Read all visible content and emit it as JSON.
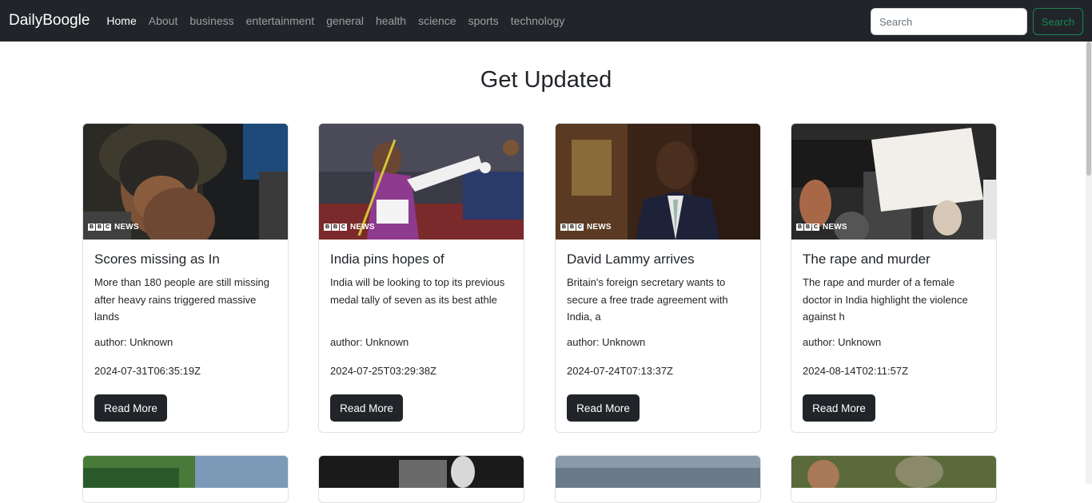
{
  "navbar": {
    "brand": "DailyBoogle",
    "links": [
      "Home",
      "About",
      "business",
      "entertainment",
      "general",
      "health",
      "science",
      "sports",
      "technology"
    ],
    "search_placeholder": "Search",
    "search_button": "Search"
  },
  "page": {
    "heading": "Get Updated"
  },
  "logo_text": {
    "bbc": [
      "B",
      "B",
      "C"
    ],
    "news": "NEWS"
  },
  "cards": [
    {
      "title": "Scores missing as In",
      "description": "More than 180 people are still missing after heavy rains triggered massive lands",
      "author": "author: Unknown",
      "date": "2024-07-31T06:35:19Z",
      "button": "Read More"
    },
    {
      "title": "India pins hopes of",
      "description": "India will be looking to top its previous medal tally of seven as its best athle",
      "author": "author: Unknown",
      "date": "2024-07-25T03:29:38Z",
      "button": "Read More"
    },
    {
      "title": "David Lammy arrives",
      "description": "Britain's foreign secretary wants to secure a free trade agreement with India, a",
      "author": "author: Unknown",
      "date": "2024-07-24T07:13:37Z",
      "button": "Read More"
    },
    {
      "title": "The rape and murder",
      "description": "The rape and murder of a female doctor in India highlight the violence against h",
      "author": "author: Unknown",
      "date": "2024-08-14T02:11:57Z",
      "button": "Read More"
    }
  ],
  "colors": {
    "navbar_bg": "#212529",
    "search_button": "#198754",
    "button_bg": "#212529"
  }
}
